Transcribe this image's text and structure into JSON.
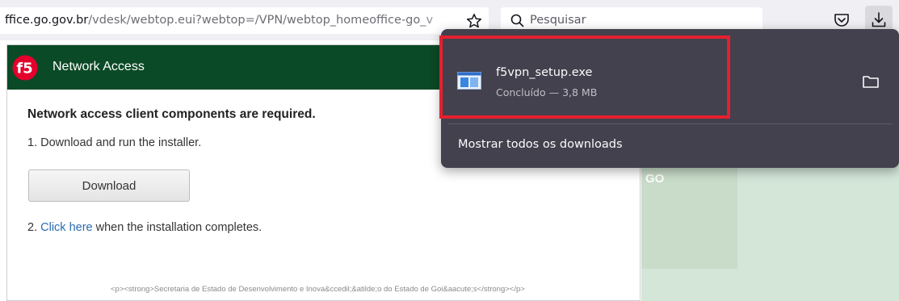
{
  "browser": {
    "url_host": "ffice.go.gov.br",
    "url_path": "/vdesk/webtop.eui?webtop=/VPN/webtop_homeoffice-go_v",
    "search_placeholder": "Pesquisar",
    "icons": [
      "star-icon",
      "search-icon",
      "pocket-icon",
      "download-icon"
    ]
  },
  "f5_page": {
    "logo_text": "f5",
    "header_title": "Network Access",
    "required_message": "Network access client components are required.",
    "step1": "1. Download and run the installer.",
    "download_label": "Download",
    "step2_prefix": "2.",
    "step2_link": "Click here",
    "step2_suffix": "when the installation completes.",
    "footer": "<p><strong>Secretaria de Estado de Desenvolvimento e Inova&ccedil;&atilde;o do Estado de Goi&aacute;s</strong></p>",
    "header_color": "#0b4a26"
  },
  "side": {
    "label": "GO"
  },
  "downloads_panel": {
    "file_name": "f5vpn_setup.exe",
    "file_status": "Concluído — 3,8 MB",
    "show_all": "Mostrar todos os downloads",
    "background_color": "#42414d",
    "highlight_color": "#e5202e"
  }
}
